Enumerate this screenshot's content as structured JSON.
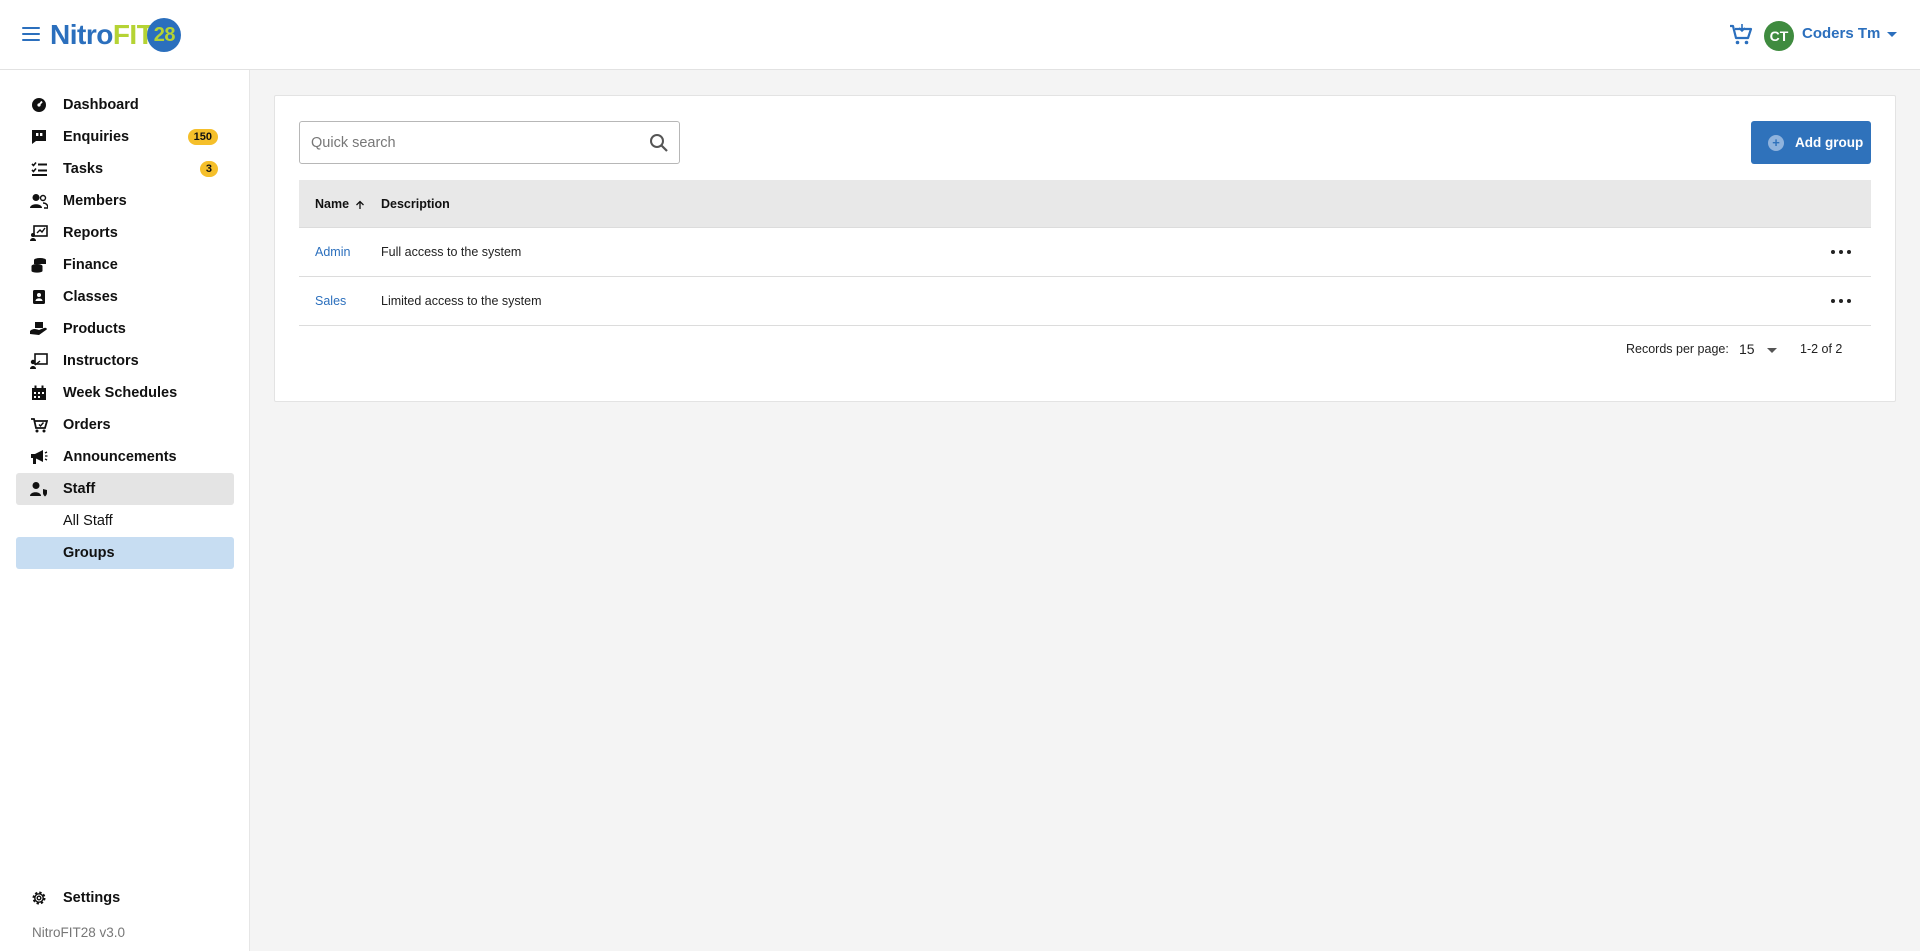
{
  "header": {
    "logo": {
      "part1": "Nitro",
      "part2": "FIT",
      "part3": "28"
    },
    "user": {
      "initials": "CT",
      "name": "Coders Tm"
    },
    "icons": {
      "menu": "menu-icon",
      "cart": "cart-icon"
    }
  },
  "sidebar": {
    "items": [
      {
        "label": "Dashboard",
        "icon": "dashboard-icon"
      },
      {
        "label": "Enquiries",
        "icon": "enquiries-icon",
        "badge": "150"
      },
      {
        "label": "Tasks",
        "icon": "tasks-icon",
        "badge": "3"
      },
      {
        "label": "Members",
        "icon": "members-icon"
      },
      {
        "label": "Reports",
        "icon": "reports-icon"
      },
      {
        "label": "Finance",
        "icon": "finance-icon"
      },
      {
        "label": "Classes",
        "icon": "classes-icon"
      },
      {
        "label": "Products",
        "icon": "products-icon"
      },
      {
        "label": "Instructors",
        "icon": "instructors-icon"
      },
      {
        "label": "Week Schedules",
        "icon": "calendar-icon"
      },
      {
        "label": "Orders",
        "icon": "orders-icon"
      },
      {
        "label": "Announcements",
        "icon": "megaphone-icon"
      },
      {
        "label": "Staff",
        "icon": "staff-icon"
      }
    ],
    "staff_sub": [
      {
        "label": "All Staff"
      },
      {
        "label": "Groups"
      }
    ],
    "settings_label": "Settings",
    "version": "NitroFIT28 v3.0"
  },
  "main": {
    "search": {
      "placeholder": "Quick search",
      "value": ""
    },
    "add_button_label": "Add group",
    "table": {
      "columns": [
        "Name",
        "Description"
      ],
      "rows": [
        {
          "name": "Admin",
          "description": "Full access to the system"
        },
        {
          "name": "Sales",
          "description": "Limited access to the system"
        }
      ]
    },
    "pagination": {
      "records_per_page_label": "Records per page:",
      "records_per_page_value": "15",
      "range": "1-2 of 2"
    }
  },
  "colors": {
    "brand_blue": "#2b6fbd",
    "brand_green": "#b5d334",
    "badge_yellow": "#f5bf2a",
    "selected_bg": "#c7ddf2",
    "avatar_green": "#3f8b3f"
  }
}
